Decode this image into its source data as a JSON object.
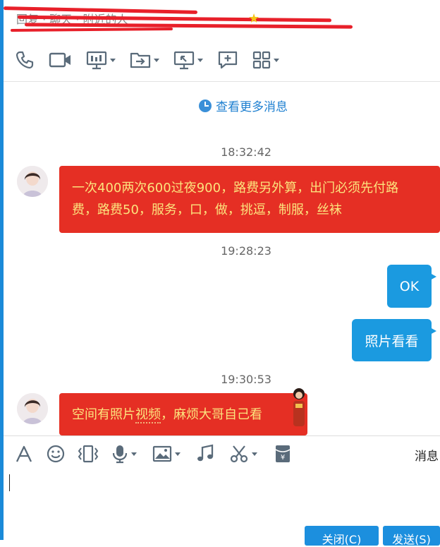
{
  "window": {
    "title": "回复 · 聊天 · 附近的人"
  },
  "toolbar_top": {
    "items": [
      {
        "icon": "phone-icon"
      },
      {
        "icon": "video-icon"
      },
      {
        "icon": "screen-share-icon"
      },
      {
        "icon": "file-transfer-icon"
      },
      {
        "icon": "remote-assist-icon"
      },
      {
        "icon": "add-chat-icon"
      },
      {
        "icon": "apps-grid-icon"
      }
    ]
  },
  "chat": {
    "more_messages": "查看更多消息",
    "messages": [
      {
        "time": "18:32:42",
        "side": "left",
        "lines": [
          "一次400两次600过夜900，路费另外算，出门必须先付路",
          "费，路费50，服务，口，做，挑逗，制服，丝袜"
        ]
      },
      {
        "time": "19:28:23",
        "side": "right",
        "text": "OK"
      },
      {
        "side": "right",
        "text": "照片看看"
      },
      {
        "time": "19:30:53",
        "side": "left",
        "parts": [
          "空间有照片",
          "视频",
          "，麻烦大哥自己看"
        ]
      }
    ]
  },
  "toolbar_bottom": {
    "items": [
      {
        "icon": "font-icon"
      },
      {
        "icon": "emoji-icon"
      },
      {
        "icon": "shake-icon"
      },
      {
        "icon": "voice-icon"
      },
      {
        "icon": "image-icon"
      },
      {
        "icon": "music-icon"
      },
      {
        "icon": "screenshot-scissors-icon"
      },
      {
        "icon": "red-packet-icon"
      }
    ],
    "message_label": "消息"
  },
  "actions": {
    "close_label": "关闭(C)",
    "send_label": "发送(S)"
  },
  "colors": {
    "accent": "#1b9ae0",
    "left_bubble": "#e52f24",
    "left_text": "#fce37d"
  }
}
